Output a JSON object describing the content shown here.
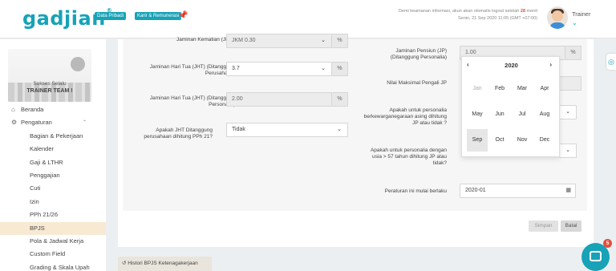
{
  "header": {
    "logo": "gadjian",
    "logo_mark": "®",
    "badges": [
      "Data Pribadi",
      "Karir & Remunerasi"
    ],
    "notice_line1_a": "Demi keamanan informasi, akun akan otomatis logout setelah ",
    "notice_minutes": "28",
    "notice_line1_b": " menit",
    "notice_line2": "Senin, 21 Sep 2020 11:05 (GMT +07:00)",
    "user_name": "Trainer"
  },
  "sidebar": {
    "banner_line1": "Sukses Selalu",
    "banner_line2": "TRAINER TEAM !",
    "items": [
      {
        "label": "Beranda",
        "icon": "home-icon"
      },
      {
        "label": "Pengaturan",
        "icon": "gears-icon"
      },
      {
        "label": "Bagian & Pekerjaan"
      },
      {
        "label": "Kalender"
      },
      {
        "label": "Gaji & LTHR"
      },
      {
        "label": "Penggajian"
      },
      {
        "label": "Cuti"
      },
      {
        "label": "Izin"
      },
      {
        "label": "PPh 21/26"
      },
      {
        "label": "BPJS"
      },
      {
        "label": "Pola & Jadwal Kerja"
      },
      {
        "label": "Custom Field"
      },
      {
        "label": "Grading & Skala Upah"
      }
    ]
  },
  "form": {
    "jkm_label": "Jaminan Kematian (JKM)",
    "jkm_value": "JKM 0.30",
    "jht_co_label": "Jaminan Hari Tua (JHT) (Ditanggung Perusahaan)",
    "jht_co_value": "3.7",
    "jht_emp_label": "Jaminan Hari Tua (JHT) (Ditanggung Personalia)",
    "jht_emp_value": "2.00",
    "jht_pph_label": "Apakah JHT Ditanggung perusahaan dihitung PPh 21?",
    "jht_pph_value": "Tidak",
    "jp_label": "Jaminan Pensiun (JP) (Ditanggung Personalia)",
    "jp_value": "1.00",
    "max_jp_label": "Nilai Maksimal Pengali JP",
    "foreign_label": "Apakah untuk personalia berkewarganegaraan asing dihitung JP atau tidak ?",
    "age_label": "Apakah untuk personalia dengan usia > 57 tahun dihitung JP atau tidak?",
    "effective_label": "Peraturan ini mulai berlaku",
    "effective_value": "2020-01",
    "percent": "%",
    "save": "Simpan",
    "cancel": "Batal",
    "history": "Histori BPJS Ketenagakerjaan"
  },
  "datepicker": {
    "year": "2020",
    "prev": "‹",
    "next": "›",
    "months": [
      "Jan",
      "Feb",
      "Mar",
      "Apr",
      "May",
      "Jun",
      "Jul",
      "Aug",
      "Sep",
      "Oct",
      "Nov",
      "Dec"
    ],
    "selected": "Sep"
  },
  "chat_badge": "5"
}
